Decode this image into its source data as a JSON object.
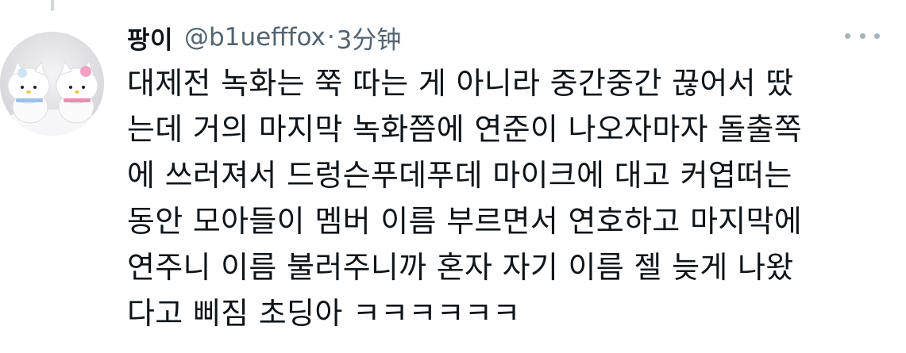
{
  "tweet": {
    "display_name": "팡이",
    "handle": "@b1uefffox",
    "separator": "·",
    "timestamp": "3分钟",
    "more_icon": "more-dots-icon",
    "avatar_icon": "avatar-image",
    "lines": [
      "대제전 녹화는 쭉 따는 게 아니라 중간중간 끊어서 땄",
      "는데 거의 마지막 녹화쯤에 연준이 나오자마자 돌출쪽",
      "에 쓰러져서 드렁슨푸데푸데 마이크에 대고 커엽떠는",
      "동안 모아들이 멤버 이름 부르면서 연호하고 마지막에",
      "연주니 이름 불러주니까 혼자 자기 이름 젤 늦게 나왔",
      "다고 삐짐 초딩아 ㅋㅋㅋㅋㅋㅋ"
    ]
  },
  "colors": {
    "text": "#0f1419",
    "secondary": "#536471",
    "thread_line": "#cfd9de"
  }
}
